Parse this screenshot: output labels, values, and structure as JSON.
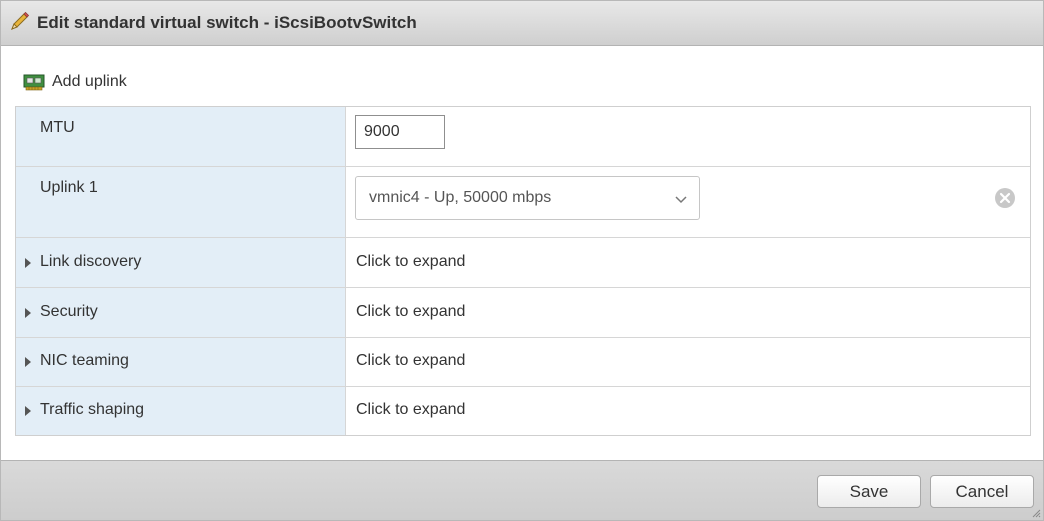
{
  "dialog": {
    "title": "Edit standard virtual switch - iScsiBootvSwitch"
  },
  "toolbar": {
    "add_uplink_label": "Add uplink"
  },
  "properties": {
    "mtu": {
      "label": "MTU",
      "value": "9000"
    },
    "uplink1": {
      "label": "Uplink 1",
      "selected": "vmnic4 - Up, 50000 mbps"
    },
    "sections": [
      {
        "label": "Link discovery",
        "value": "Click to expand"
      },
      {
        "label": "Security",
        "value": "Click to expand"
      },
      {
        "label": "NIC teaming",
        "value": "Click to expand"
      },
      {
        "label": "Traffic shaping",
        "value": "Click to expand"
      }
    ]
  },
  "footer": {
    "save_label": "Save",
    "cancel_label": "Cancel"
  },
  "colors": {
    "label_column_bg": "#e3eef7",
    "title_bar_bg": "#d8d8d8",
    "remove_icon": "#c8c8c8"
  },
  "icons": {
    "title": "pencil-icon",
    "add_uplink": "network-card-icon",
    "uplink_remove": "close-circle-icon",
    "select": "chevron-down-icon",
    "section_toggle": "caret-right-icon"
  }
}
